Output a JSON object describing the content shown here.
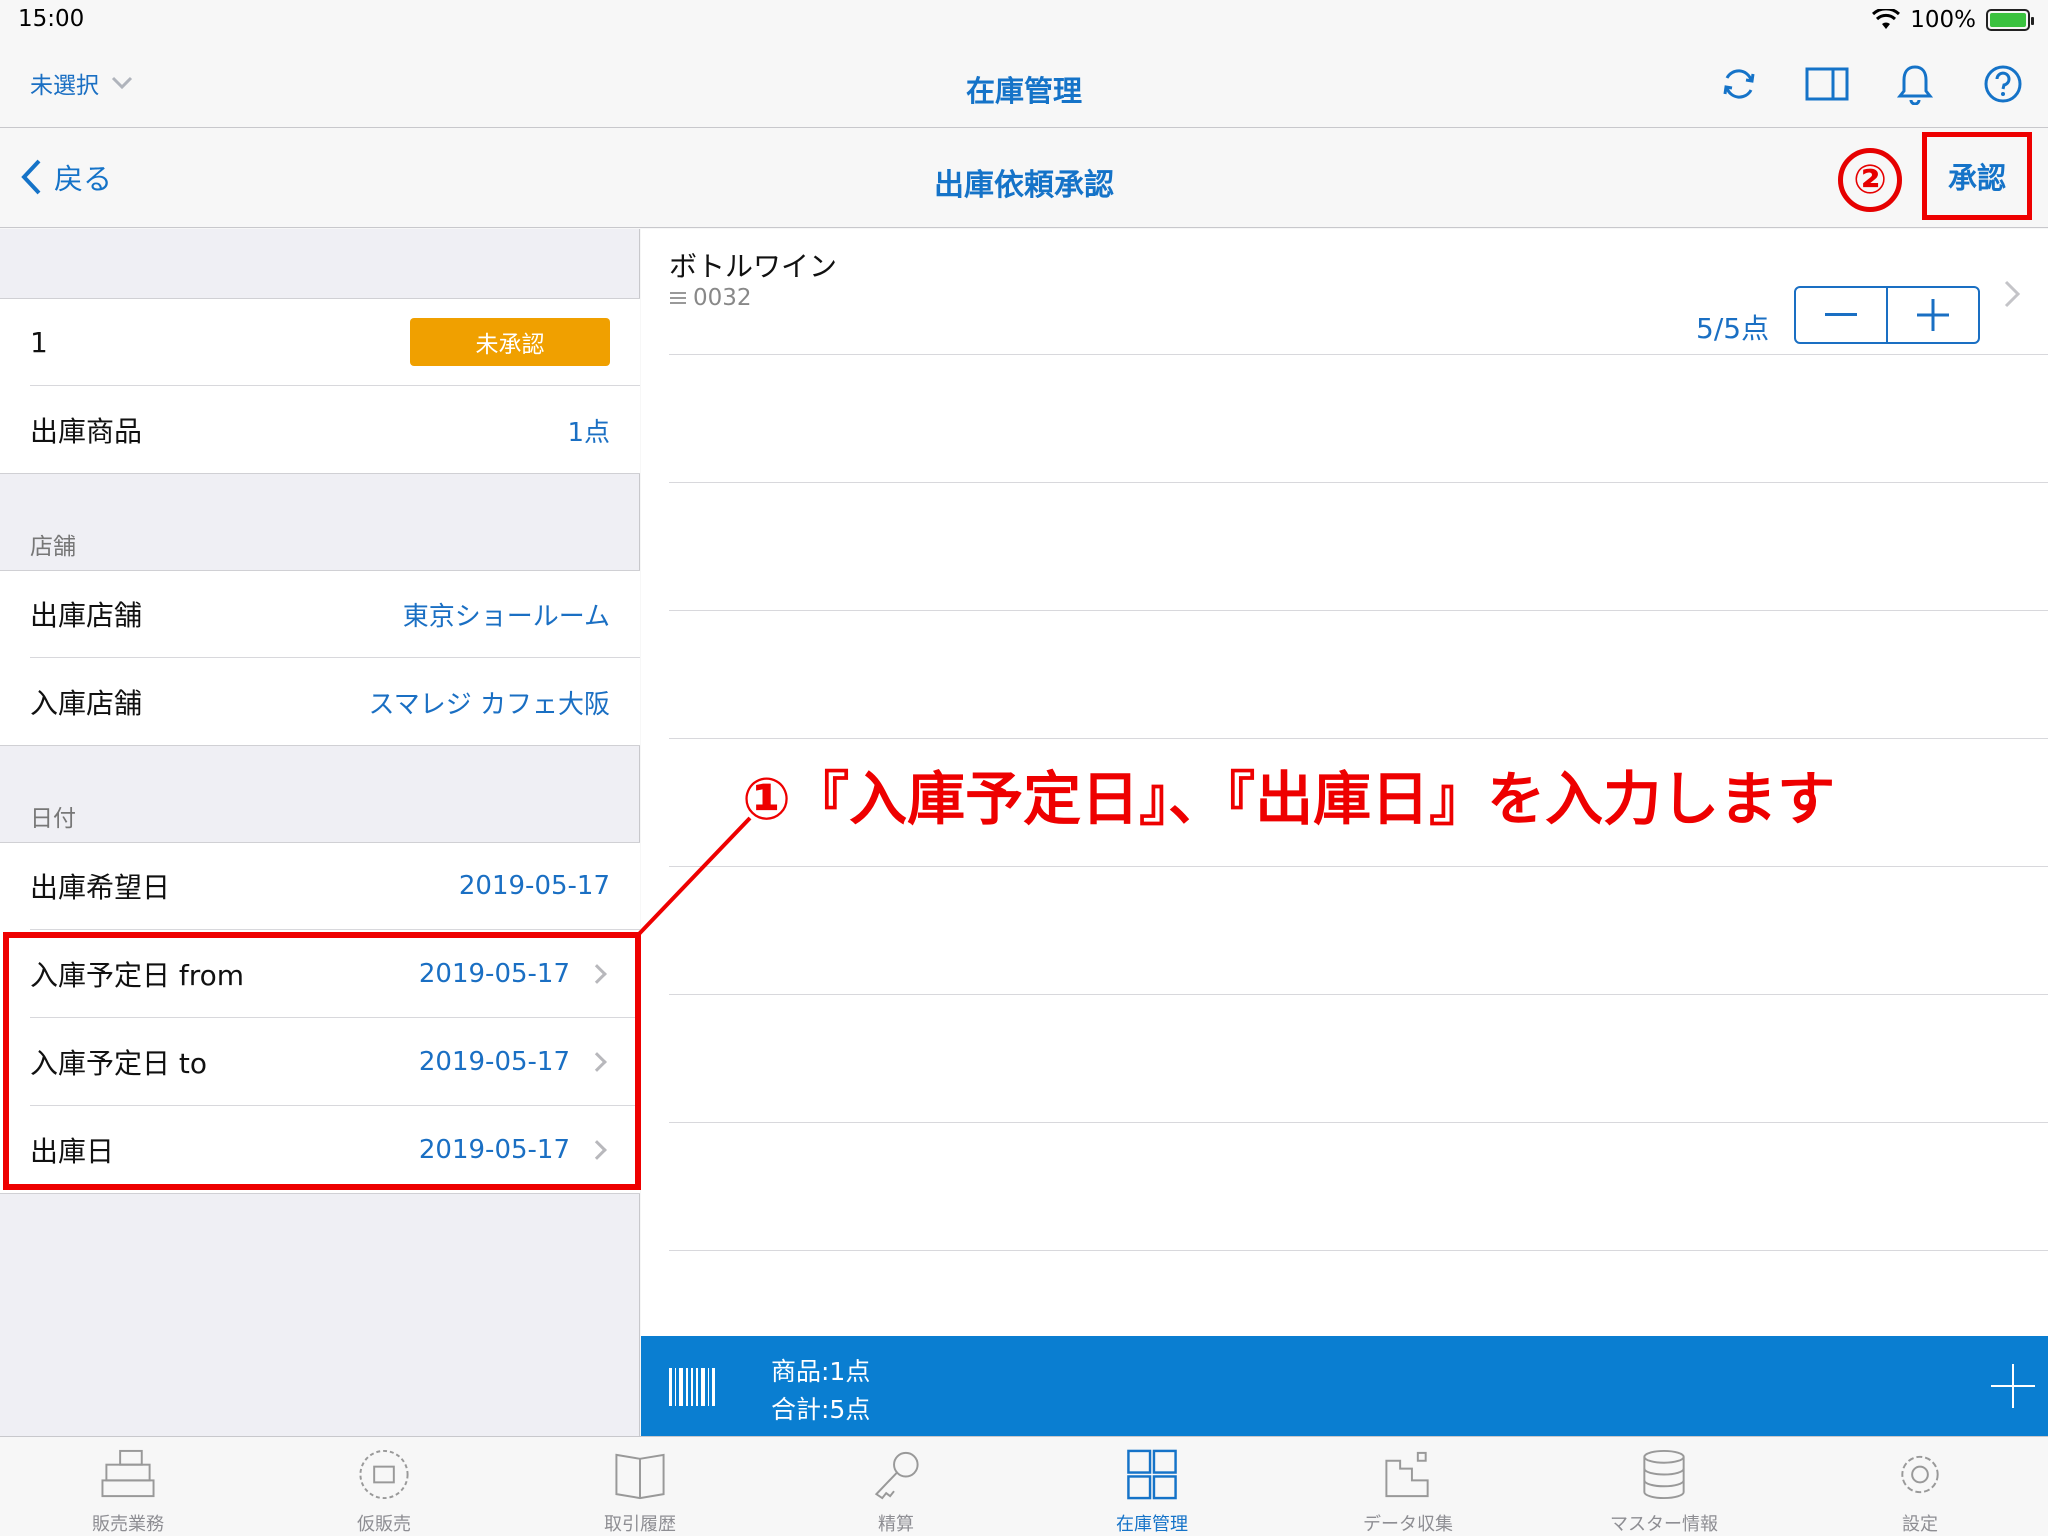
{
  "status": {
    "time": "15:00",
    "battery": "100%"
  },
  "topbar": {
    "store_select": "未選択",
    "title": "在庫管理"
  },
  "subheader": {
    "back": "戻る",
    "title": "出庫依頼承認",
    "approve": "承認",
    "step2": "②"
  },
  "detail": {
    "number": "1",
    "status_badge": "未承認",
    "product_label": "出庫商品",
    "product_value": "1点",
    "section_store": "店舗",
    "out_store_label": "出庫店舗",
    "out_store_value": "東京ショールーム",
    "in_store_label": "入庫店舗",
    "in_store_value": "スマレジ カフェ大阪",
    "section_date": "日付",
    "desired_date_label": "出庫希望日",
    "desired_date_value": "2019-05-17",
    "in_from_label": "入庫予定日 from",
    "in_from_value": "2019-05-17",
    "in_to_label": "入庫予定日 to",
    "in_to_value": "2019-05-17",
    "out_date_label": "出庫日",
    "out_date_value": "2019-05-17"
  },
  "items": [
    {
      "name": "ボトルワイン",
      "code": "0032",
      "qty": "5/5点"
    }
  ],
  "annotation": "①『入庫予定日』、『出庫日』を入力します",
  "footer": {
    "products": "商品:1点",
    "total": "合計:5点"
  },
  "tabs": [
    {
      "label": "販売業務",
      "icon": "register-icon"
    },
    {
      "label": "仮販売",
      "icon": "temp-register-icon"
    },
    {
      "label": "取引履歴",
      "icon": "book-icon"
    },
    {
      "label": "精算",
      "icon": "key-icon"
    },
    {
      "label": "在庫管理",
      "icon": "inventory-icon",
      "active": true
    },
    {
      "label": "データ収集",
      "icon": "data-icon"
    },
    {
      "label": "マスター情報",
      "icon": "database-icon"
    },
    {
      "label": "設定",
      "icon": "gear-icon"
    }
  ],
  "colors": {
    "accent": "#1573c8",
    "pending": "#f0a000",
    "annotation": "#ee0000",
    "footer_bar": "#0a7ed1"
  }
}
